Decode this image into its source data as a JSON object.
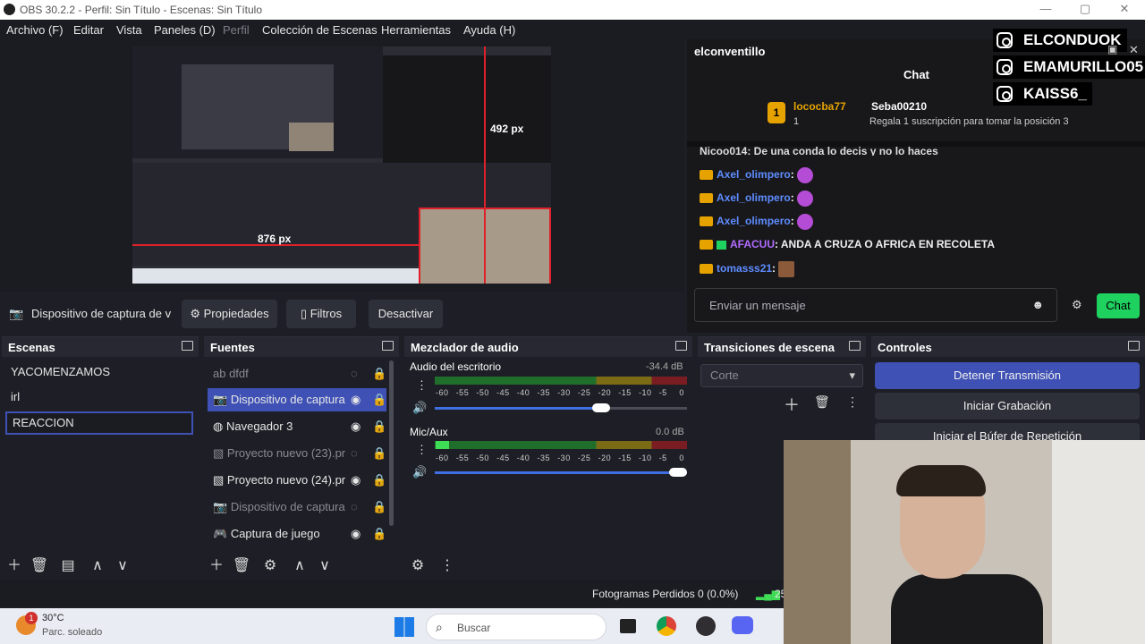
{
  "window": {
    "title": "OBS 30.2.2 - Perfil: Sin Título - Escenas: Sin Título"
  },
  "menu": [
    "Archivo (F)",
    "Editar",
    "Vista",
    "Paneles (D)",
    "Perfil",
    "Colección de Escenas",
    "Herramientas",
    "Ayuda (H)"
  ],
  "preview": {
    "width_label": "492 px",
    "height_label": "876 px"
  },
  "context": {
    "source": "Dispositivo de captura de v",
    "properties": "Propiedades",
    "filters": "Filtros",
    "deactivate": "Desactivar"
  },
  "scenes": {
    "title": "Escenas",
    "items": [
      "YACOMENZAMOS",
      "irl",
      "REACCION"
    ]
  },
  "sources": {
    "title": "Fuentes",
    "items": [
      {
        "name": "dfdf",
        "icon": "text-icon",
        "visible": false
      },
      {
        "name": "Dispositivo de captura",
        "icon": "camera-icon",
        "visible": true
      },
      {
        "name": "Navegador 3",
        "icon": "browser-icon",
        "visible": true
      },
      {
        "name": "Proyecto nuevo (23).pr",
        "icon": "image-icon",
        "visible": false
      },
      {
        "name": "Proyecto nuevo (24).pr",
        "icon": "image-icon",
        "visible": true
      },
      {
        "name": "Dispositivo de captura",
        "icon": "camera-icon",
        "visible": false
      },
      {
        "name": "Captura de juego",
        "icon": "gamepad-icon",
        "visible": true
      }
    ]
  },
  "mixer": {
    "title": "Mezclador de audio",
    "channels": [
      {
        "name": "Audio del escritorio",
        "db": "-34.4 dB",
        "volume": 0.66
      },
      {
        "name": "Mic/Aux",
        "db": "0.0 dB",
        "volume": 1.0
      }
    ],
    "scale": [
      "-60",
      "-55",
      "-50",
      "-45",
      "-40",
      "-35",
      "-30",
      "-25",
      "-20",
      "-15",
      "-10",
      "-5",
      "0"
    ]
  },
  "transitions": {
    "title": "Transiciones de escena",
    "selected": "Corte"
  },
  "controls": {
    "title": "Controles",
    "stop_stream": "Detener Transmisión",
    "start_rec": "Iniciar Grabación",
    "replay": "Iniciar el Búfer de Repetición"
  },
  "status": {
    "dropped": "Fotogramas Perdidos 0 (0.0%)",
    "fps": "25"
  },
  "chat": {
    "channel": "elconventillo",
    "header": "Chat",
    "gift": {
      "user": "lococba77",
      "count": "1",
      "to": "Seba00210",
      "text": "Regala 1 suscripción para tomar la posición 3"
    },
    "truncated": "Nicoo014: De una conda lo decis y no lo haces",
    "messages": [
      {
        "user": "Axel_olimpero",
        "text": ""
      },
      {
        "user": "Axel_olimpero",
        "text": ""
      },
      {
        "user": "Axel_olimpero",
        "text": ""
      },
      {
        "user": "AFACUU",
        "text": "ANDA A CRUZA O AFRICA EN RECOLETA"
      },
      {
        "user": "tomasss21",
        "text": ""
      }
    ],
    "placeholder": "Enviar un mensaje",
    "send": "Chat"
  },
  "socials": [
    "ELCONDUOK",
    "EMAMURILLO05",
    "KAISS6_"
  ],
  "taskbar": {
    "temp": "30°C",
    "weather": "Parc. soleado",
    "search": "Buscar",
    "badge": "1"
  },
  "colors": {
    "accent": "#3f51b5",
    "twitch": "#1fd15e",
    "name_blue": "#5e8cff",
    "afacuu": "#b16cff"
  }
}
